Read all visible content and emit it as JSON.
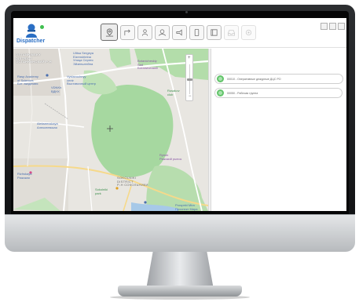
{
  "app": {
    "name": "Dispatcher"
  },
  "toolbar": {
    "buttons": [
      {
        "icon": "map-pin-icon",
        "active": true
      },
      {
        "icon": "route-icon",
        "active": false
      },
      {
        "icon": "person-icon",
        "active": false
      },
      {
        "icon": "group-icon",
        "active": false
      },
      {
        "icon": "megaphone-icon",
        "active": false
      },
      {
        "icon": "phone-icon",
        "active": false
      },
      {
        "icon": "contacts-icon",
        "active": false
      },
      {
        "icon": "inbox-icon",
        "active": false,
        "disabled": true
      },
      {
        "icon": "settings-icon",
        "active": false,
        "disabled": true
      }
    ]
  },
  "map": {
    "labels": {
      "ostankinsky": "OSTANKINSKY\nDISTRICT\nОСТАНКИНСКИЙ Р-Н",
      "sokolniki": "SOKOLNIKI\nDISTRICT\nР-Н СОКОЛЬНИКИ",
      "ulitsa": "Ulitsa Sergeya\nEizenshteina\nУлица Сергея\nЭйзенштейна",
      "botanical": "Botanicheskiy\nSad\nБотанический",
      "academy": "Rasp Academy\nof Sciences\nБот. академия",
      "exhibition": "Vystavochnyy\ncentr\nВыставочный центр",
      "vdnh": "VDNKh\nВДНХ",
      "alekseevskaya": "Alekseevskaya\nАлексеевская",
      "rizhskaya": "Rizhskaya\nРижская",
      "rynok": "Rynok\nРижский рынок",
      "sokolniki_park": "Sokolniki\npark",
      "rusakov": "Rusakov\nclub",
      "prospekt": "Prospekt Mira\nПроспект Мира"
    }
  },
  "panel": {
    "items": [
      {
        "label": "00010 - Оперативные дежурные ДЦС РО",
        "status_color": "#62c46a"
      },
      {
        "label": "00050 - Рабочая группа",
        "status_color": "#62c46a"
      }
    ]
  },
  "colors": {
    "accent": "#2b6fc4",
    "status_ok": "#62c46a",
    "park": "#a6d8a0"
  }
}
